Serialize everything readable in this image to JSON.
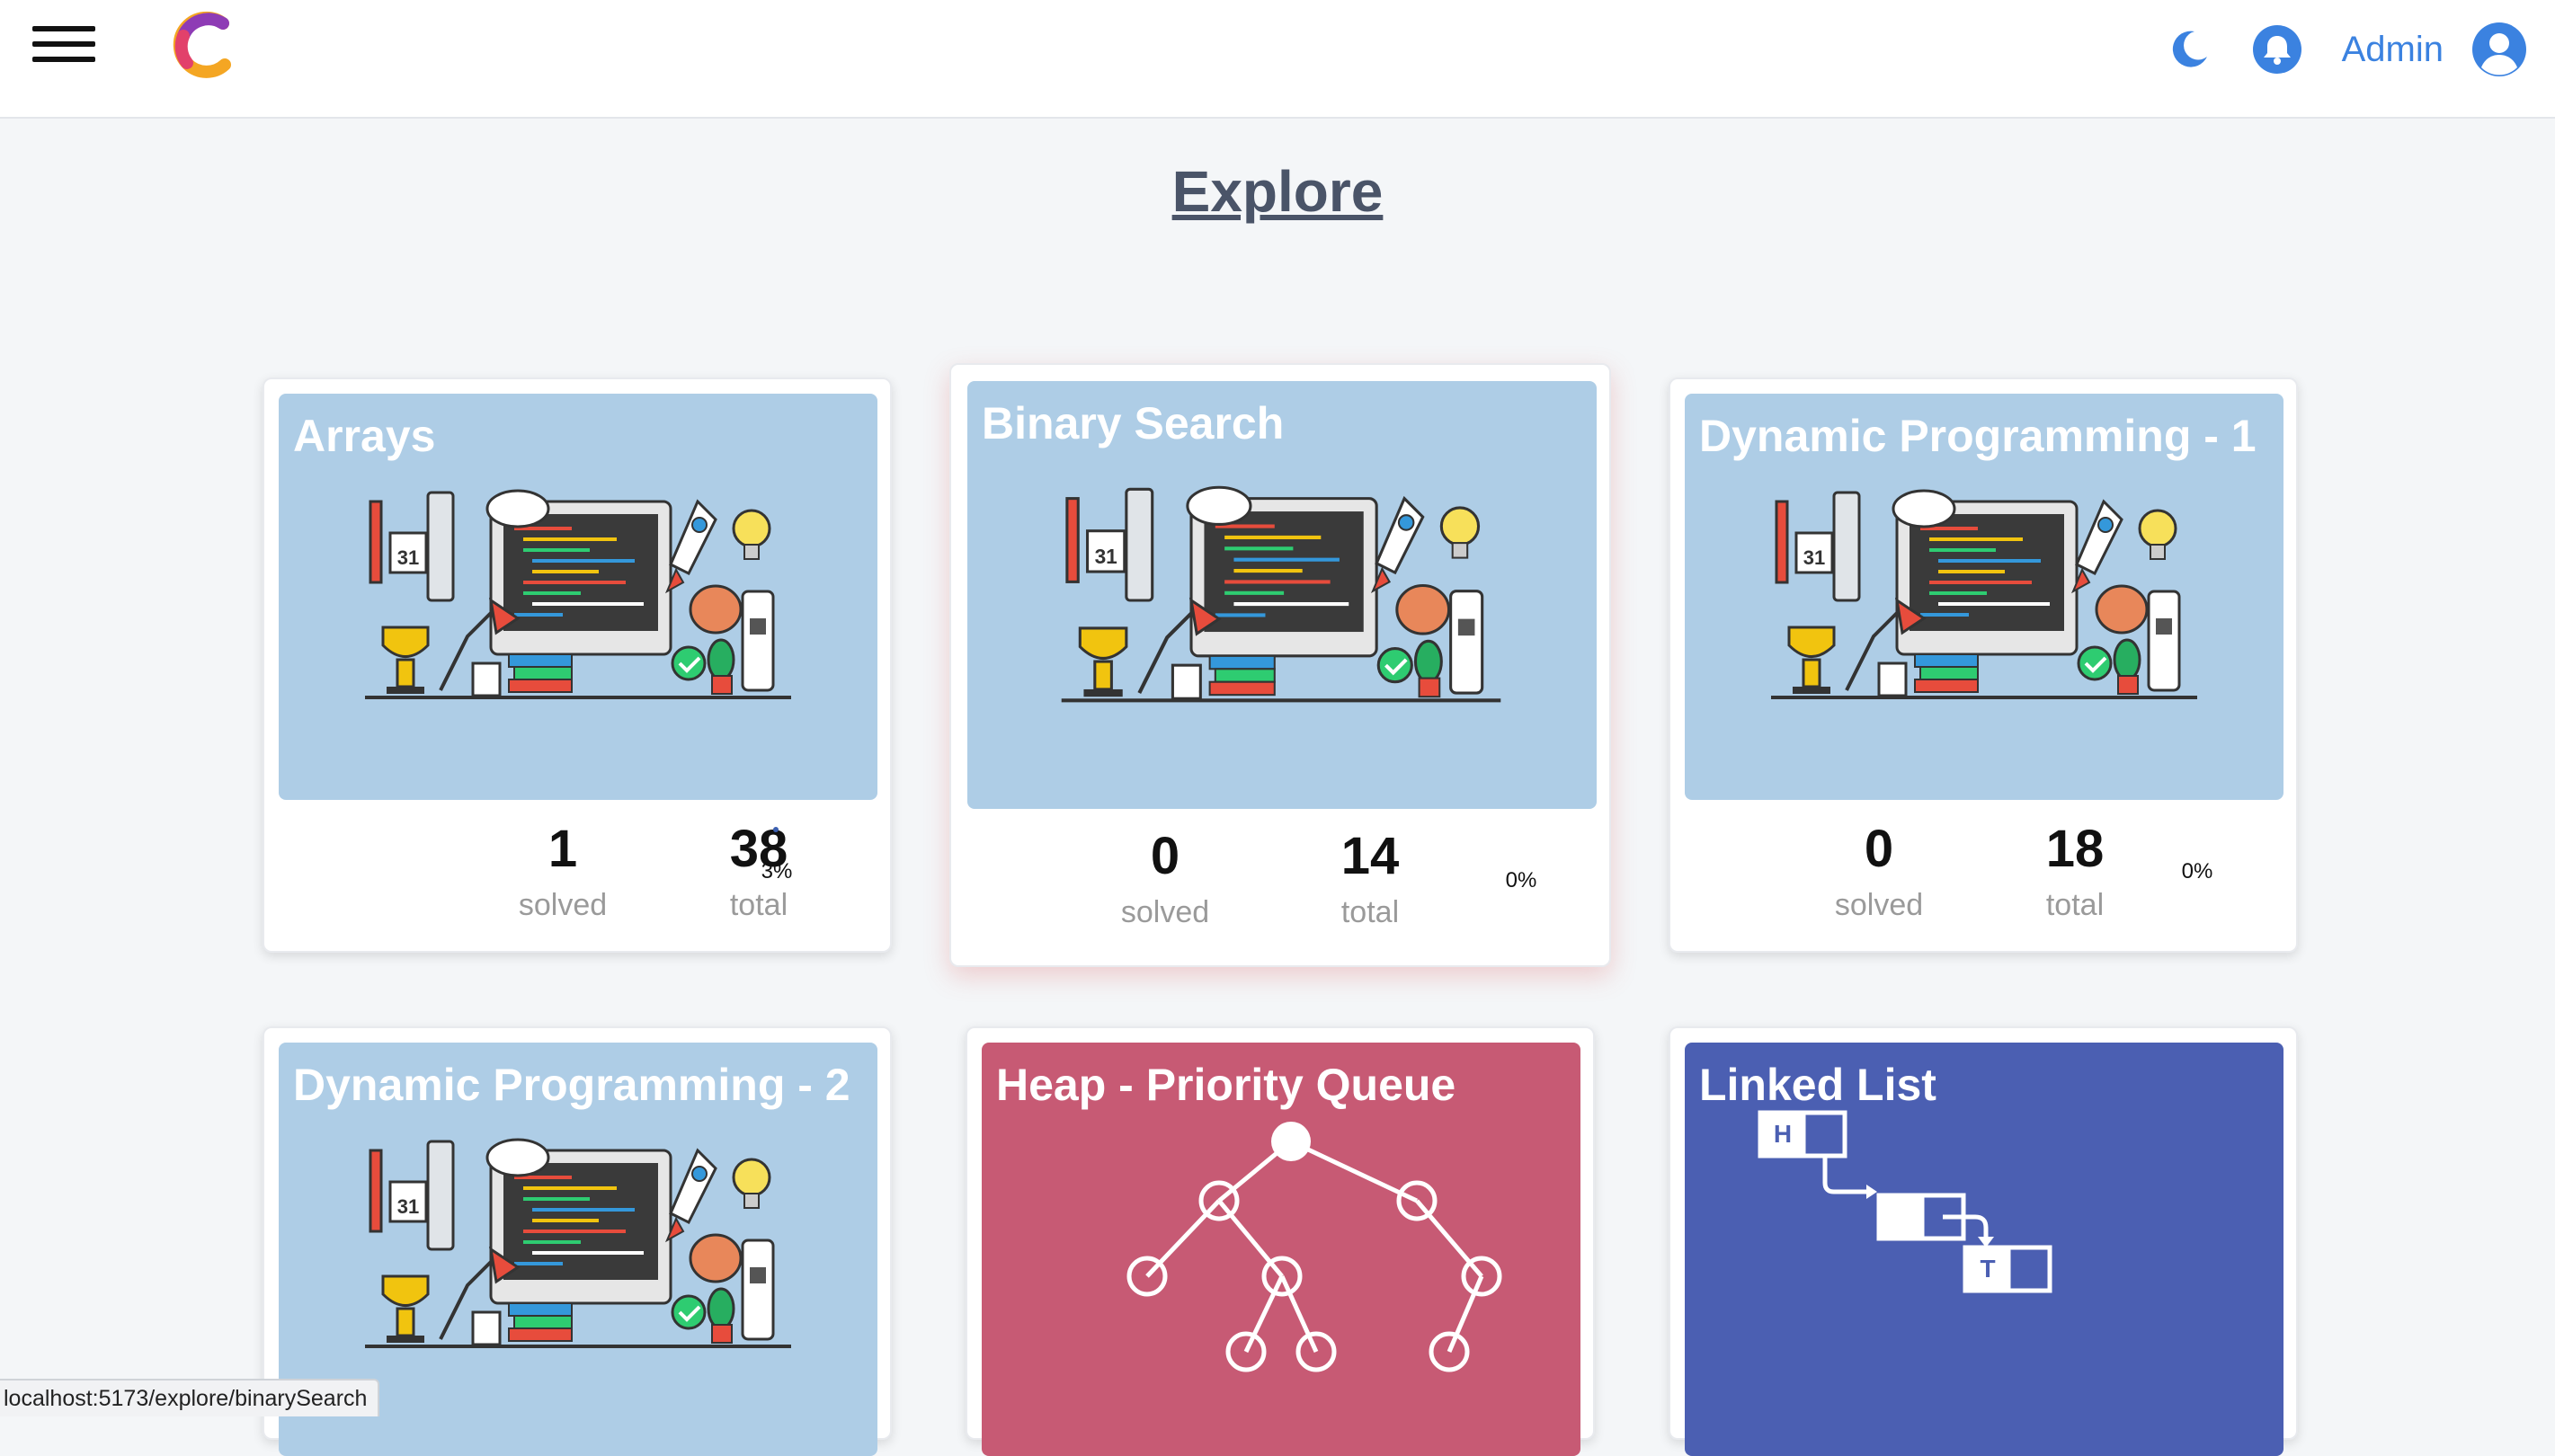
{
  "header": {
    "admin_label": "Admin",
    "icons": [
      "menu-icon",
      "logo",
      "moon-icon",
      "bell-icon",
      "user-avatar-icon"
    ],
    "accent": "#3b82e0"
  },
  "page": {
    "title": "Explore"
  },
  "cards": [
    {
      "title": "Arrays",
      "solved": "1",
      "solved_label": "solved",
      "total": "38",
      "total_label": "total",
      "percent": "3%",
      "theme": "#aecde6"
    },
    {
      "title": "Binary Search",
      "solved": "0",
      "solved_label": "solved",
      "total": "14",
      "total_label": "total",
      "percent": "0%",
      "theme": "#aecde6"
    },
    {
      "title": "Dynamic Programming - 1",
      "solved": "0",
      "solved_label": "solved",
      "total": "18",
      "total_label": "total",
      "percent": "0%",
      "theme": "#aecde6"
    },
    {
      "title": "Dynamic Programming - 2",
      "theme": "#aecde6"
    },
    {
      "title": "Heap - Priority Queue",
      "theme": "#c75a74"
    },
    {
      "title": "Linked List",
      "theme": "#4b5fb2",
      "node_labels": [
        "H",
        "T"
      ]
    }
  ],
  "statusbar": {
    "url": "localhost:5173/explore/binarySearch"
  }
}
